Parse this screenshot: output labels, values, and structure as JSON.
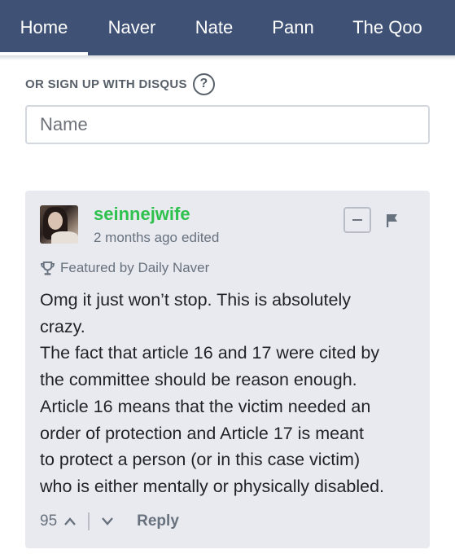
{
  "nav": {
    "tabs": [
      {
        "label": "Home",
        "active": true
      },
      {
        "label": "Naver"
      },
      {
        "label": "Nate"
      },
      {
        "label": "Pann"
      },
      {
        "label": "The Qoo"
      }
    ]
  },
  "signup": {
    "label": "OR SIGN UP WITH DISQUS",
    "help_glyph": "?"
  },
  "name_field": {
    "placeholder": "Name",
    "value": ""
  },
  "comment": {
    "username": "seinnejwife",
    "time": "2 months ago",
    "edited": "edited",
    "featured": "Featured by Daily Naver",
    "lines": [
      "Omg it just won’t stop. This is absolutely",
      "crazy.",
      "The fact that article 16 and 17 were cited by",
      "the committee should be reason enough.",
      "Article 16 means that the victim needed an",
      "order of protection and Article 17 is meant",
      "to protect a person (or in this case victim)",
      "who is either mentally or physically disabled."
    ],
    "votes": "95",
    "reply_label": "Reply"
  },
  "colors": {
    "navbar": "#3f5276",
    "username": "#2ec14d",
    "comment_bg": "#e8eaef",
    "muted_text": "#68717e"
  },
  "icons": [
    "help-icon",
    "minus-icon",
    "flag-icon",
    "trophy-icon",
    "chevron-up-icon",
    "chevron-down-icon"
  ]
}
